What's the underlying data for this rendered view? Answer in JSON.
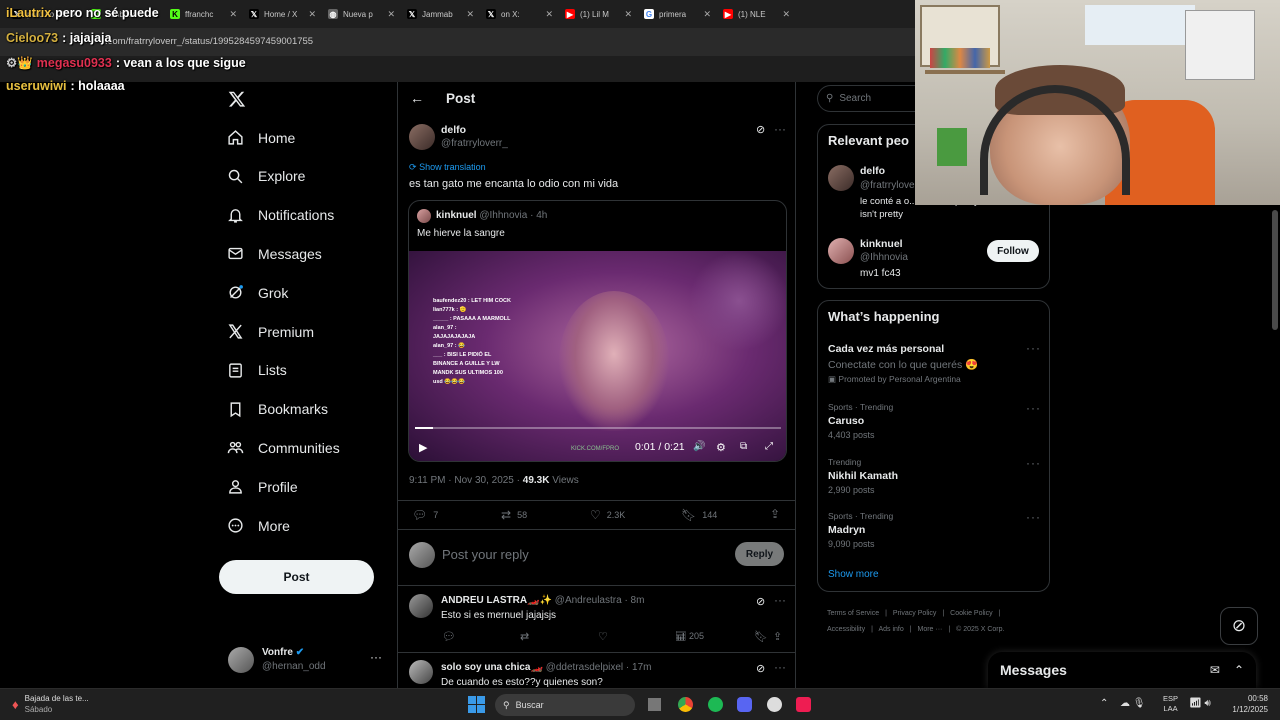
{
  "browser": {
    "tabs": [
      {
        "label": "pero no sé puede",
        "icon": "x-icon"
      },
      {
        "label": "irunbosc",
        "icon": "kick-icon"
      },
      {
        "label": "ffranchc",
        "icon": "kick-icon"
      },
      {
        "label": "Home / X",
        "icon": "x-icon"
      },
      {
        "label": "Nueva p",
        "icon": "globe-icon"
      },
      {
        "label": "Jammab",
        "icon": "x-icon"
      },
      {
        "label": "on X:",
        "icon": "x-icon"
      },
      {
        "label": "(1) Lil M",
        "icon": "youtube-icon"
      },
      {
        "label": "primera",
        "icon": "google-icon"
      },
      {
        "label": "(1) NLE",
        "icon": "youtube-icon"
      }
    ],
    "url": ".com/fratrryloverr_/status/1995284597459001755"
  },
  "chat_overlay": [
    {
      "user": "iLautrix",
      "color": "#f0c040",
      "text": "pero no sé puede"
    },
    {
      "user": "Cieloo73",
      "color": "#d4b040",
      "text": ": jajajaja"
    },
    {
      "user": "megasu0933",
      "color": "#e03050",
      "text": ": vean a los que sigue"
    },
    {
      "user": "useruwiwi",
      "color": "#e8c040",
      "text": ": holaaaa"
    }
  ],
  "nav": {
    "items": [
      "Home",
      "Explore",
      "Notifications",
      "Messages",
      "Grok",
      "Premium",
      "Lists",
      "Bookmarks",
      "Communities",
      "Profile",
      "More"
    ],
    "post_button": "Post",
    "account": {
      "name": "Vonfre",
      "handle": "@hernan_odd"
    }
  },
  "post": {
    "header_title": "Post",
    "author_name": "delfo",
    "author_handle": "@fratrryloverr_",
    "show_translation": "Show translation",
    "text": "es tan gato me encanta lo odio con mi vida",
    "quoted": {
      "author_name": "kinknuel",
      "author_handle": "@Ihhnovia",
      "time": "· 4h",
      "text": "Me hierve la sangre",
      "video": {
        "time": "0:01 / 0:21",
        "progress": 0.05,
        "chat_lines": [
          "baufendez20 : LET HIM COCK",
          "lian777k : 🫡",
          "_____ : PASAAA A MARMOLL",
          "alan_97 :",
          "JAJAJAJAJAJA",
          "alan_97 : 😂",
          "___ : BISI LE PIDIÓ EL BINANCE A GUILLE Y LW MANDK SUS ULTIMOS 100 usd 😂😂😂"
        ],
        "kick_watermark": "KICK.COM/FPRO"
      }
    },
    "timestamp": "9:11 PM · Nov 30, 2025 ·",
    "views_count": "49.3K",
    "views_label": "Views",
    "stats": {
      "replies": "7",
      "reposts": "58",
      "likes": "2.3K",
      "bookmarks": "144"
    },
    "reply_placeholder": "Post your reply",
    "reply_button": "Reply"
  },
  "replies": [
    {
      "name": "ANDREU LASTRA🏎️✨",
      "handle": "@Andreulastra",
      "time": "· 8m",
      "text": "Esto si es mernuel jajajsjs",
      "views": "205"
    },
    {
      "name": "solo soy una chica🏎️",
      "handle": "@ddetrasdelpixel",
      "time": "· 17m",
      "text": "De cuando es esto??y quienes son?"
    }
  ],
  "right": {
    "search_placeholder": "Search",
    "relevant_title": "Relevant peo",
    "relevant": [
      {
        "name": "delfo",
        "handle": "@fratrryloverr_",
        "bio": "le conté a o... escribió pretty isn't pretty"
      },
      {
        "name": "kinknuel",
        "handle": "@Ihhnovia",
        "bio": "mv1 fc43",
        "button": "Follow"
      }
    ],
    "happening_title": "What’s happening",
    "trends": [
      {
        "context": "",
        "title": "Cada vez más personal",
        "sub": "Conectate con lo que querés 😍",
        "extra": "Promoted by Personal Argentina"
      },
      {
        "context": "Sports · Trending",
        "title": "Caruso",
        "sub": "4,403 posts"
      },
      {
        "context": "Trending",
        "title": "Nikhil Kamath",
        "sub": "2,990 posts"
      },
      {
        "context": "Sports · Trending",
        "title": "Madryn",
        "sub": "9,090 posts"
      }
    ],
    "show_more": "Show more",
    "footer": [
      "Terms of Service",
      "Privacy Policy",
      "Cookie Policy",
      "Accessibility",
      "Ads info",
      "More ···",
      "© 2025 X Corp."
    ],
    "messages_drawer": "Messages"
  },
  "taskbar": {
    "notification_title": "Bajada de las te...",
    "notification_sub": "Sábado",
    "search": "Buscar",
    "lang": "ESP",
    "lang2": "LAA",
    "time": "00:58",
    "date": "1/12/2025"
  },
  "colors": {
    "accent": "#1d9bf0",
    "bg": "#000000",
    "border": "#2f3336"
  }
}
